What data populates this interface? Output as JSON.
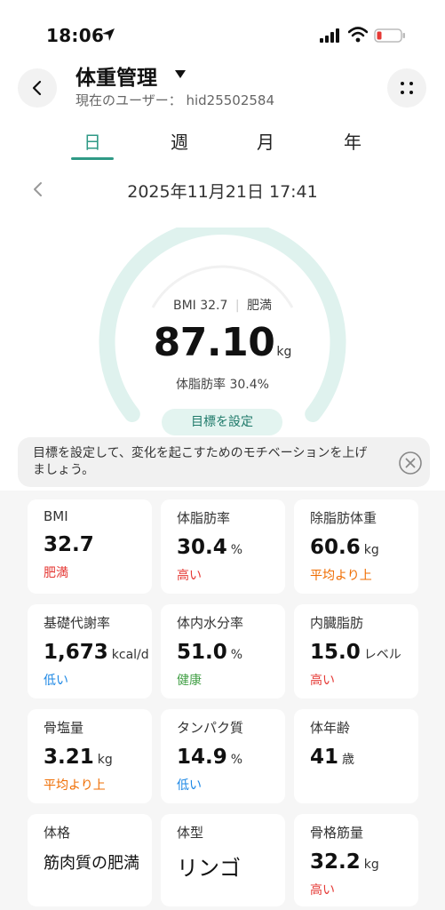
{
  "status_bar": {
    "time": "18:06"
  },
  "header": {
    "title": "体重管理",
    "subtitle": "現在のユーザー：  hid25502584"
  },
  "tabs": [
    {
      "label": "日",
      "active": true
    },
    {
      "label": "週",
      "active": false
    },
    {
      "label": "月",
      "active": false
    },
    {
      "label": "年",
      "active": false
    }
  ],
  "date": "2025年11月21日 17:41",
  "gauge": {
    "bmi_text": "BMI 32.7",
    "bmi_category": "肥満",
    "weight": "87.10",
    "weight_unit": "kg",
    "fat_text": "体脂肪率 30.4%",
    "goal_button": "目標を設定"
  },
  "tip": {
    "text": "目標を設定して、変化を起こすためのモチベーションを上げましょう。"
  },
  "metrics": [
    {
      "label": "BMI",
      "value": "32.7",
      "unit": "",
      "status": "肥満",
      "status_color": "#e53935"
    },
    {
      "label": "体脂肪率",
      "value": "30.4",
      "unit": "%",
      "status": "高い",
      "status_color": "#e53935"
    },
    {
      "label": "除脂肪体重",
      "value": "60.6",
      "unit": "kg",
      "status": "平均より上",
      "status_color": "#ef6c00"
    },
    {
      "label": "基礎代謝率",
      "value": "1,673",
      "unit": "kcal/d",
      "status": "低い",
      "status_color": "#1e88e5"
    },
    {
      "label": "体内水分率",
      "value": "51.0",
      "unit": "%",
      "status": "健康",
      "status_color": "#43a047"
    },
    {
      "label": "内臓脂肪",
      "value": "15.0",
      "unit": "レベル",
      "status": "高い",
      "status_color": "#e53935"
    },
    {
      "label": "骨塩量",
      "value": "3.21",
      "unit": "kg",
      "status": "平均より上",
      "status_color": "#ef6c00"
    },
    {
      "label": "タンパク質",
      "value": "14.9",
      "unit": "%",
      "status": "低い",
      "status_color": "#1e88e5"
    },
    {
      "label": "体年齢",
      "value": "41",
      "unit": "歳",
      "status": "",
      "status_color": ""
    },
    {
      "label": "体格",
      "text_value": "筋肉質の肥満",
      "status": ""
    },
    {
      "label": "体型",
      "text_value": "リンゴ",
      "status": ""
    },
    {
      "label": "骨格筋量",
      "value": "32.2",
      "unit": "kg",
      "status": "高い",
      "status_color": "#e53935"
    }
  ],
  "colors": {
    "accent": "#2f9a86",
    "gauge_track": "#dff2ee",
    "battery_low": "#e53935"
  }
}
